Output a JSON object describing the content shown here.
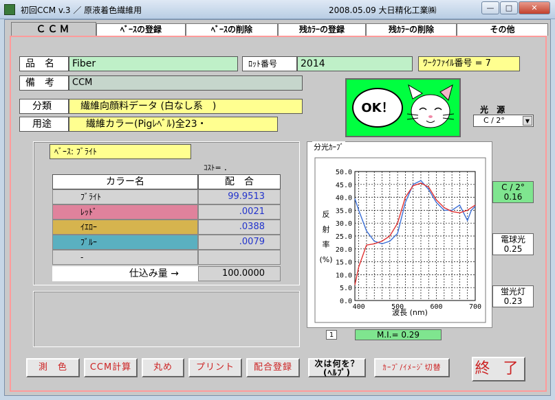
{
  "window": {
    "title": "初回CCM  v.3 ／ 原液着色繊維用",
    "right_text": "2008.05.09  大日精化工業㈱",
    "minimize": "—",
    "maximize": "□",
    "close": "✕"
  },
  "tabs": [
    "ＣＣＭ",
    "ﾍﾞｰｽの登録",
    "ﾍﾞｰｽの削除",
    "残ｶﾗｰの登録",
    "残ｶﾗｰの削除",
    "その他"
  ],
  "form": {
    "product_label": "品　名",
    "product_value": "Fiber",
    "lot_label": "ﾛｯﾄ番号",
    "lot_value": "2014",
    "workfile": "ﾜｰｸﾌｧｲﾙ番号 = 7",
    "remarks_label": "備　考",
    "remarks_value": "CCM",
    "category_label": "分類",
    "category_value": "繊維向顔料データ (白なし系　)",
    "usage_label": "用途",
    "usage_value": "繊維カラー(Pigﾚﾍﾞﾙ)全23・"
  },
  "ok": {
    "text": "OK！"
  },
  "base": "ﾍﾞｰｽ: ﾌﾞﾗｲﾄ",
  "cost": "ｺｽﾄ= ．",
  "table": {
    "col_name": "カラー名",
    "col_mix": "配　合",
    "rows": [
      {
        "name": "ﾌﾞﾗｲﾄ",
        "value": "99.9513",
        "color": "#d4d4d4"
      },
      {
        "name": "ﾚｯﾄﾞ",
        "value": ".0021",
        "color": "#e0829c"
      },
      {
        "name": "ｲｴﾛｰ",
        "value": ".0388",
        "color": "#d6b44e"
      },
      {
        "name": "ﾌﾞﾙｰ",
        "value": ".0079",
        "color": "#5ab0c0"
      },
      {
        "name": "-",
        "value": "",
        "color": "#d4d4d4"
      }
    ],
    "total_label": "仕込み量 →",
    "total_value": "100.0000"
  },
  "light": {
    "label": "光 源",
    "selected": "C / 2°",
    "sources": [
      {
        "name": "C / 2°",
        "value": "0.16"
      },
      {
        "name": "電球光",
        "value": "0.25"
      },
      {
        "name": "蛍光灯",
        "value": "0.23"
      }
    ]
  },
  "chart_data": {
    "type": "line",
    "title": "分光ｶｰﾌﾞ",
    "xlabel": "波長 (nm)",
    "ylabel": "反射率(%)",
    "xlim": [
      390,
      700
    ],
    "ylim": [
      0,
      50
    ],
    "x_ticks": [
      "400",
      "500",
      "600",
      "700"
    ],
    "y_ticks": [
      "0.0",
      "5.0",
      "10.0",
      "15.0",
      "20.0",
      "25.0",
      "30.0",
      "35.0",
      "40.0",
      "45.0",
      "50.0"
    ],
    "grid": true,
    "x": [
      390,
      400,
      420,
      440,
      460,
      480,
      500,
      520,
      540,
      560,
      580,
      600,
      620,
      640,
      660,
      680,
      690,
      700
    ],
    "series": [
      {
        "color": "#3b6fd6",
        "values": [
          39.5,
          35,
          27,
          23,
          22,
          23,
          26,
          38,
          45,
          46.5,
          43,
          38,
          35,
          35,
          37,
          31,
          35,
          36.5
        ]
      },
      {
        "color": "#e03030",
        "values": [
          6,
          13,
          21.5,
          22,
          23,
          25,
          30,
          40,
          44.5,
          45.5,
          44,
          39,
          36,
          34.5,
          34,
          35,
          36,
          37
        ]
      }
    ]
  },
  "bottom": {
    "page": "1",
    "mi": "M.I.= 0.29",
    "buttons": [
      "測　色",
      "CCM計算",
      "丸め",
      "プリント",
      "配合登録",
      "次は何を？\n(ﾍﾙﾌﾟ)",
      "ｶｰﾌﾞ/ｲﾒｰｼﾞ切替",
      "終 了"
    ]
  }
}
